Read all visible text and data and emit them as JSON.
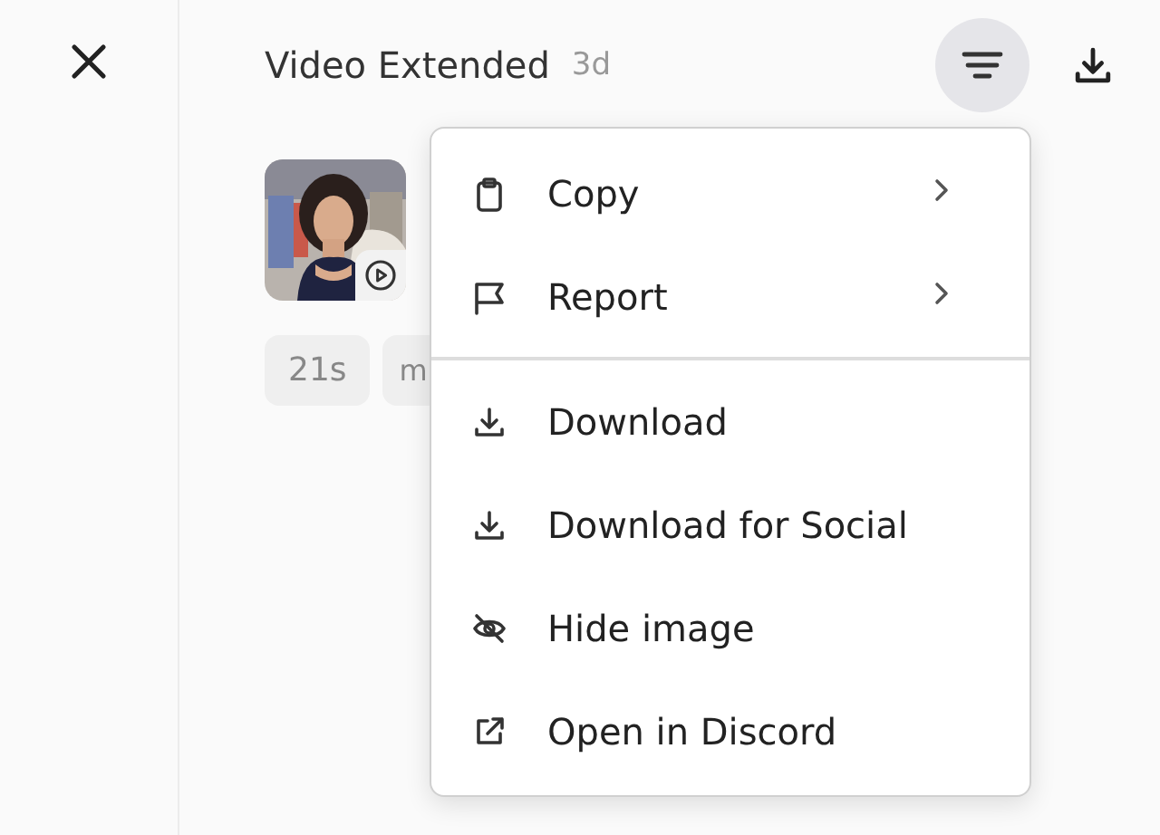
{
  "header": {
    "title": "Video Extended",
    "age": "3d",
    "menu_open": true
  },
  "media": {
    "kind": "picture",
    "chips": [
      "21s",
      "m"
    ]
  },
  "menu": {
    "sections": [
      [
        {
          "kind": "clipboard",
          "label": "Copy",
          "submenu": true
        },
        {
          "kind": "flag",
          "label": "Report",
          "submenu": true
        }
      ],
      [
        {
          "kind": "download",
          "label": "Download",
          "submenu": false
        },
        {
          "kind": "download",
          "label": "Download for Social",
          "submenu": false
        },
        {
          "kind": "hidden",
          "label": "Hide image",
          "submenu": false
        },
        {
          "kind": "external",
          "label": "Open in Discord",
          "submenu": false
        }
      ]
    ]
  }
}
